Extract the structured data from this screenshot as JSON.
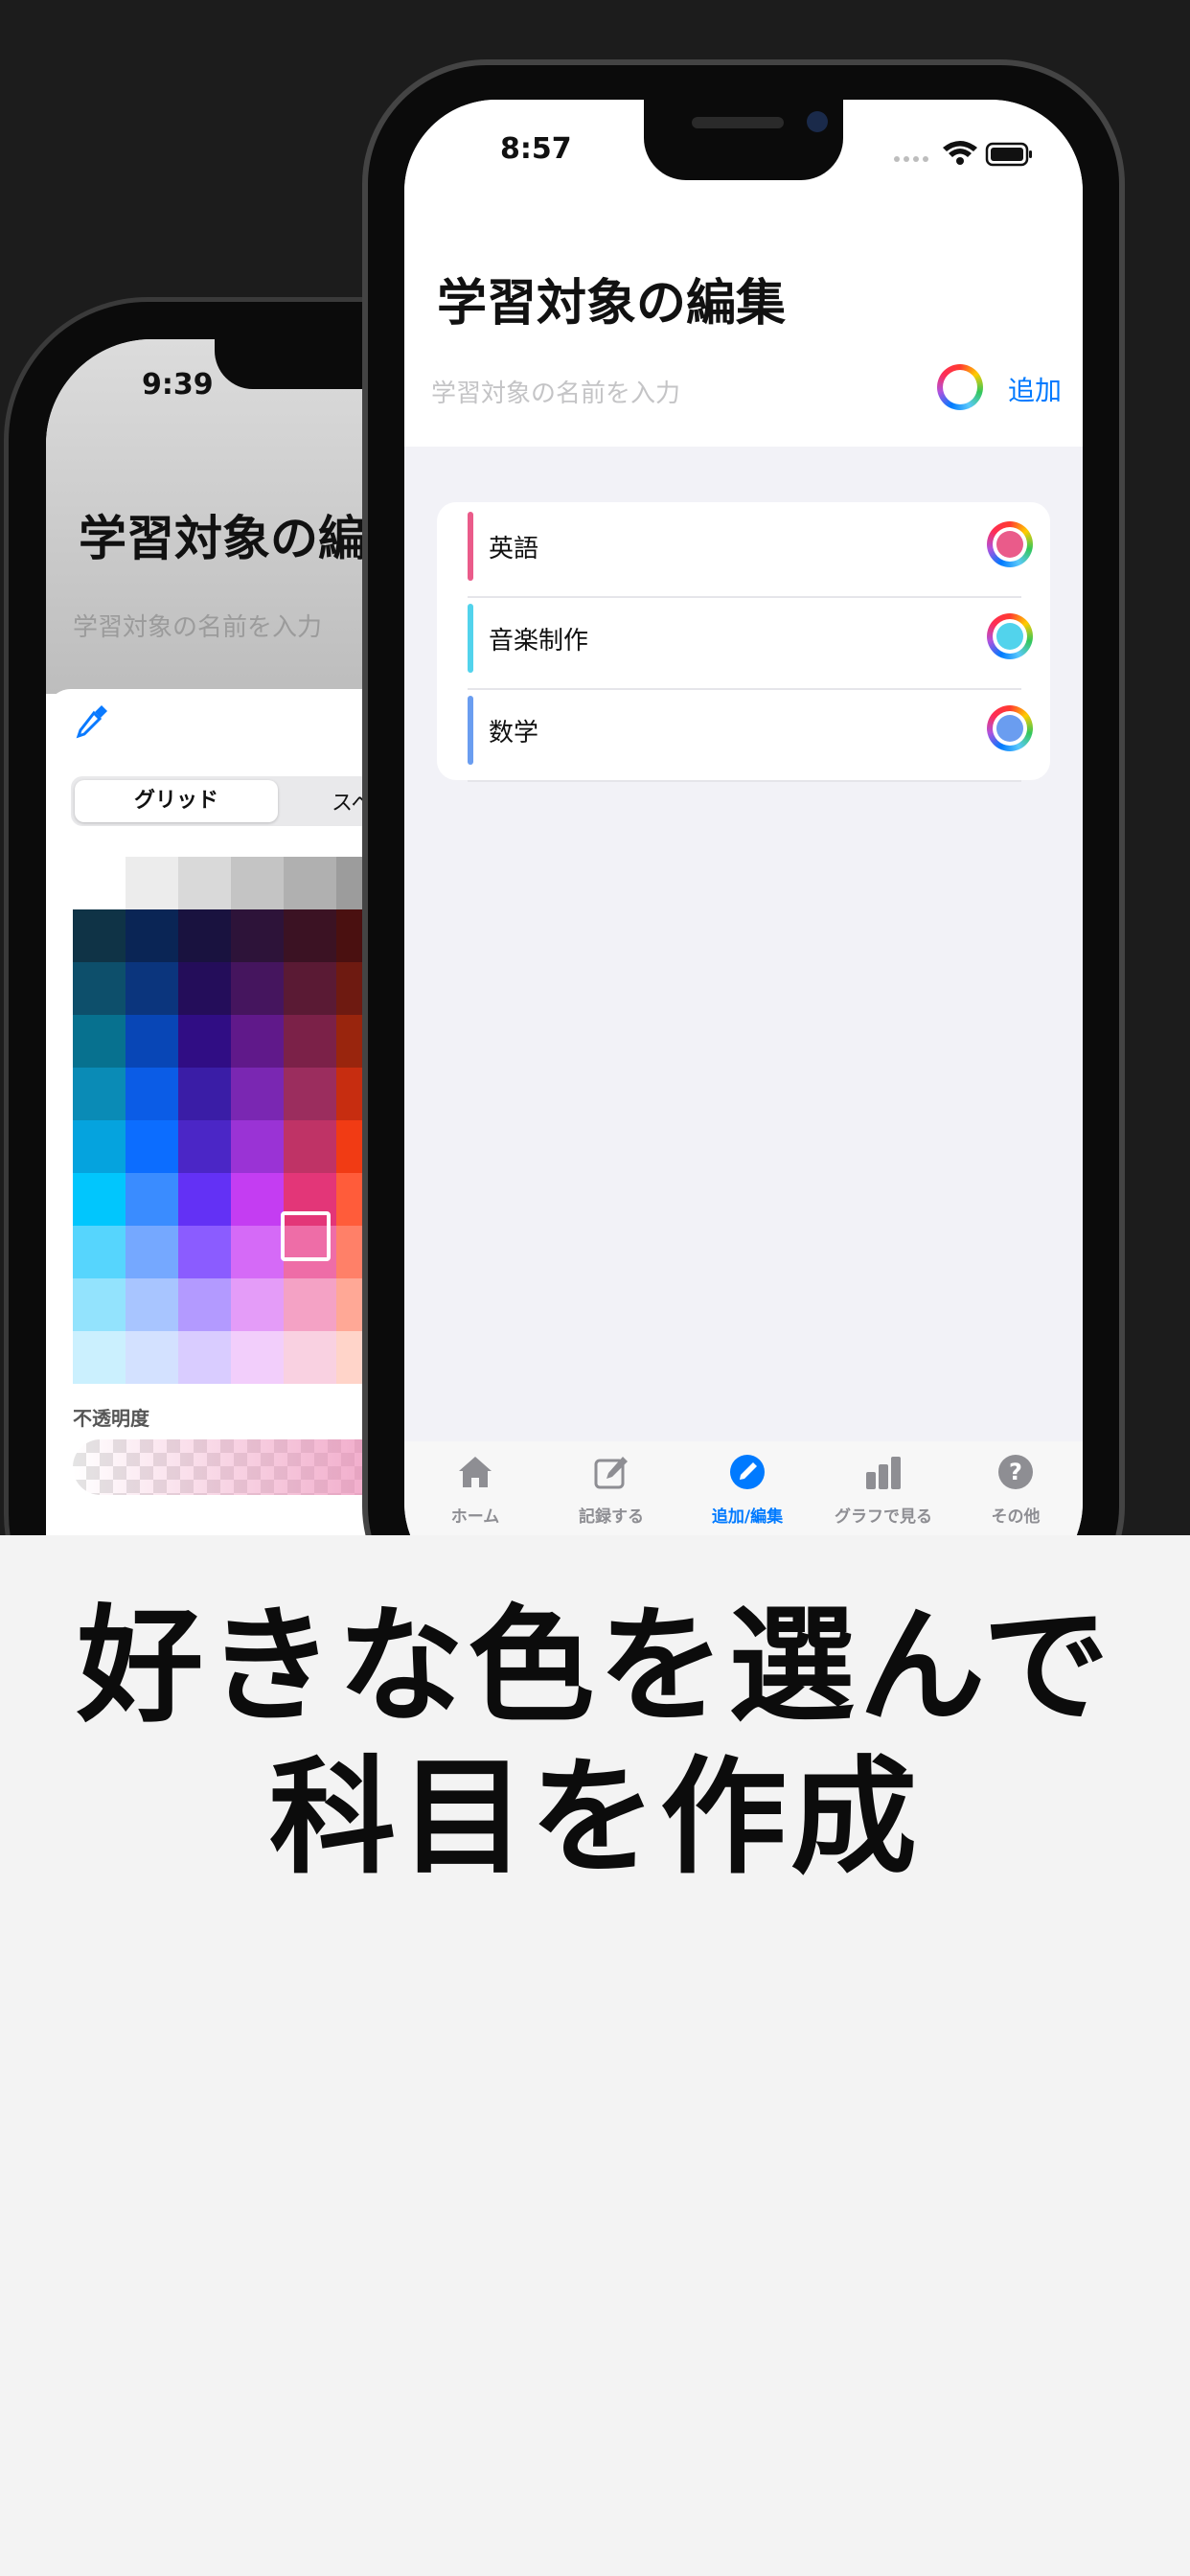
{
  "back_screen": {
    "time": "9:39",
    "title": "学習対象の編",
    "placeholder": "学習対象の名前を入力",
    "segments": {
      "active": "グリッド",
      "other": "スペ"
    },
    "opacity_label": "不透明度",
    "grid_colors": [
      [
        "#ffffff",
        "#ececec",
        "#d9d9d9",
        "#c4c4c4",
        "#b0b0b0",
        "#9c9c9c"
      ],
      [
        "#0f3346",
        "#0a2555",
        "#19123f",
        "#2d1339",
        "#3b1223",
        "#4a1010"
      ],
      [
        "#0d4f6b",
        "#0b357d",
        "#240d5a",
        "#45155e",
        "#5a1a34",
        "#6e1a11"
      ],
      [
        "#07718f",
        "#0846b6",
        "#300d84",
        "#60198a",
        "#7b2148",
        "#99250d"
      ],
      [
        "#0a8bb6",
        "#0b5ce6",
        "#3a1da6",
        "#7a27b2",
        "#9b2d5e",
        "#c72d10"
      ],
      [
        "#05a3de",
        "#0c6dff",
        "#4b26c6",
        "#9a33d5",
        "#bf3366",
        "#f13b14"
      ],
      [
        "#01c6fd",
        "#3a8cff",
        "#6331f5",
        "#c43df2",
        "#e33678",
        "#ff5c3a"
      ],
      [
        "#56d5fd",
        "#75a8ff",
        "#8b5cff",
        "#d56af7",
        "#ee6da7",
        "#ff8068"
      ],
      [
        "#93e3fd",
        "#a8c5ff",
        "#b39aff",
        "#e49cf8",
        "#f4a2c5",
        "#ffa896"
      ],
      [
        "#cbf0fe",
        "#d3e1ff",
        "#d9ccff",
        "#f2cefb",
        "#f9d1e1",
        "#ffd4c9"
      ]
    ]
  },
  "front_screen": {
    "time": "8:57",
    "title": "学習対象の編集",
    "name_placeholder": "学習対象の名前を入力",
    "add_label": "追加",
    "subjects": [
      {
        "label": "英語",
        "color": "#ea5b8a"
      },
      {
        "label": "音楽制作",
        "color": "#52d3ec"
      },
      {
        "label": "数学",
        "color": "#6a9df0"
      }
    ],
    "tabs": [
      {
        "label": "ホーム",
        "icon": "home-icon",
        "active": false
      },
      {
        "label": "記録する",
        "icon": "edit-icon",
        "active": false
      },
      {
        "label": "追加/編集",
        "icon": "pencil-circle-icon",
        "active": true
      },
      {
        "label": "グラフで見る",
        "icon": "bar-chart-icon",
        "active": false
      },
      {
        "label": "その他",
        "icon": "question-icon",
        "active": false
      }
    ],
    "accent_color": "#007aff"
  },
  "headline": {
    "line1": "好きな色を選んで",
    "line2": "科目を作成"
  }
}
